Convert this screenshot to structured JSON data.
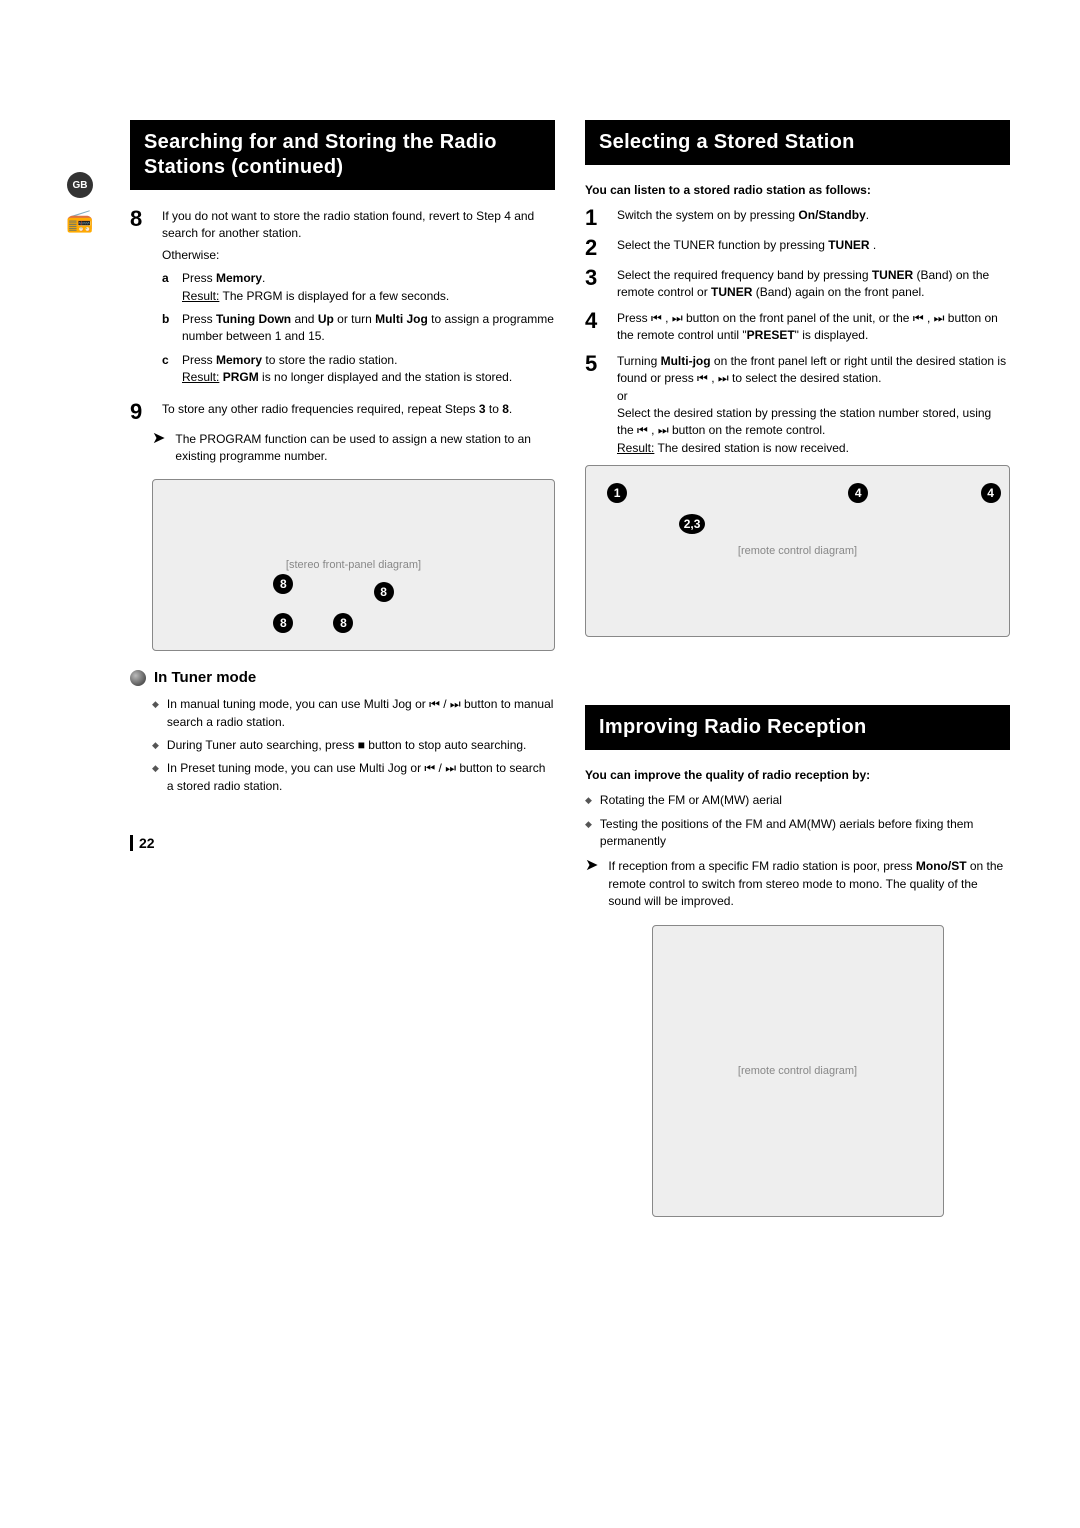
{
  "gutter": {
    "gb": "GB"
  },
  "left": {
    "heading": "Searching for and Storing the Radio Stations (continued)",
    "step8": {
      "num": "8",
      "intro": "If you do not want to store the radio station found, revert to Step 4 and search for another station.",
      "otherwise": "Otherwise:",
      "a_letter": "a",
      "a": "Press Memory.",
      "a_result_label": "Result:",
      "a_result": "The PRGM is displayed for a few seconds.",
      "b_letter": "b",
      "b": "Press Tuning Down and Up or turn Multi Jog to assign a programme number between 1 and 15.",
      "c_letter": "c",
      "c": "Press Memory to store the radio station.",
      "c_result_label": "Result:",
      "c_result": "PRGM is no longer displayed and the station is stored."
    },
    "step9": {
      "num": "9",
      "text": "To store any other radio frequencies required, repeat Steps 3 to 8."
    },
    "note1": "The PROGRAM function can be used to assign a new station to an existing programme number.",
    "device_placeholder": "[stereo front-panel diagram]",
    "callouts_device": [
      "8",
      "8",
      "8",
      "8"
    ],
    "tuner_title": "In Tuner mode",
    "tuner_items": [
      "In manual tuning mode, you can use Multi Jog or ⏮ / ⏭ button to manual search a radio station.",
      "During Tuner auto searching, press ■ button to stop auto searching.",
      "In Preset tuning mode, you can use Multi Jog or ⏮ / ⏭ button to search a stored radio station."
    ],
    "page_number": "22"
  },
  "right": {
    "heading1": "Selecting a Stored Station",
    "sub1": "You can listen to a stored radio station as follows:",
    "s1": {
      "num": "1",
      "text": "Switch the system on by pressing On/Standby."
    },
    "s2": {
      "num": "2",
      "text": "Select the TUNER function by pressing TUNER ."
    },
    "s3": {
      "num": "3",
      "text": "Select the required frequency band by pressing TUNER (Band) on the remote control or TUNER (Band) again on the front panel."
    },
    "s4": {
      "num": "4",
      "text": "Press ⏮ , ⏭ button on the front panel of the unit, or the ⏮ , ⏭ button on the remote control until \"PRESET\" is displayed."
    },
    "s5": {
      "num": "5",
      "text": "Turning Multi-jog on the front panel left or right until the desired station is found or press ⏮ , ⏭ to select the desired station.",
      "or": "or",
      "text2": "Select the desired station by pressing the station number stored, using the ⏮ , ⏭ button on the remote control.",
      "result_label": "Result:",
      "result": "The desired station is now received."
    },
    "remote_placeholder": "[remote control diagram]",
    "callouts_remote": [
      "1",
      "2,3",
      "4",
      "4"
    ],
    "heading2": "Improving Radio Reception",
    "sub2": "You can improve the quality of radio reception by:",
    "improve_items": [
      "Rotating the FM or AM(MW) aerial",
      "Testing the positions of the FM and AM(MW) aerials before fixing them permanently"
    ],
    "note2": "If reception from a specific FM radio station is poor, press Mono/ST on the remote control to switch from stereo mode to mono. The quality of the sound will be improved.",
    "remote2_placeholder": "[remote control diagram]"
  }
}
